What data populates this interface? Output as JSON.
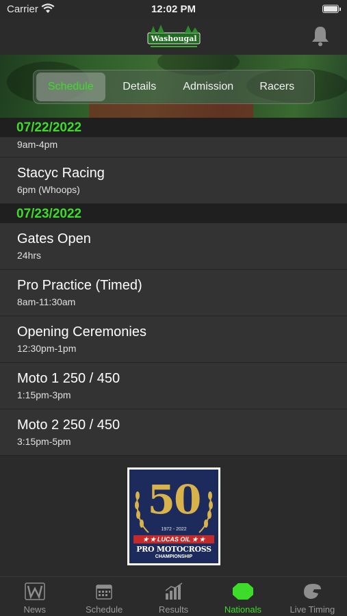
{
  "status_bar": {
    "carrier": "Carrier",
    "time": "12:02 PM"
  },
  "logo_text": "Washougal",
  "tabs_segment": [
    {
      "label": "Schedule",
      "active": true
    },
    {
      "label": "Details",
      "active": false
    },
    {
      "label": "Admission",
      "active": false
    },
    {
      "label": "Racers",
      "active": false
    }
  ],
  "schedule": {
    "day1": {
      "date": "07/22/2022",
      "partial_sub": "9am-4pm",
      "items": [
        {
          "title": "Stacyc Racing",
          "time": "6pm (Whoops)"
        }
      ]
    },
    "day2": {
      "date": "07/23/2022",
      "items": [
        {
          "title": "Gates Open",
          "time": "24hrs"
        },
        {
          "title": "Pro Practice (Timed)",
          "time": "8am-11:30am"
        },
        {
          "title": "Opening Ceremonies",
          "time": "12:30pm-1pm"
        },
        {
          "title": "Moto 1 250 / 450",
          "time": "1:15pm-3pm"
        },
        {
          "title": "Moto 2 250 / 450",
          "time": "3:15pm-5pm"
        }
      ]
    }
  },
  "badge": {
    "number": "50",
    "years": "1972 - 2022",
    "sponsor": "★ ★ LUCAS OIL ★ ★",
    "line1": "PRO MOTOCROSS",
    "line2": "CHAMPIONSHIP"
  },
  "bottom_tabs": [
    {
      "label": "News",
      "icon": "w-logo-icon",
      "active": false
    },
    {
      "label": "Schedule",
      "icon": "calendar-icon",
      "active": false
    },
    {
      "label": "Results",
      "icon": "bar-chart-icon",
      "active": false
    },
    {
      "label": "Nationals",
      "icon": "nationals-badge-icon",
      "active": true
    },
    {
      "label": "Live Timing",
      "icon": "helmet-icon",
      "active": false
    }
  ],
  "colors": {
    "accent": "#3ddc2a",
    "background": "#2b2b2b",
    "row": "#333333",
    "section": "#1f1f1f"
  }
}
